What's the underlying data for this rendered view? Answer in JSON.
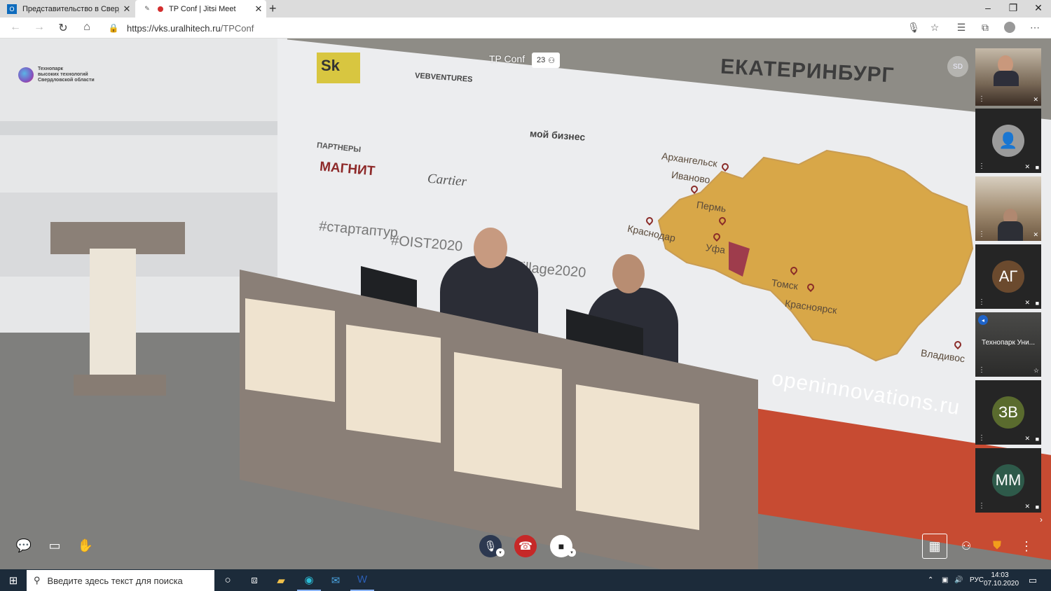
{
  "browser": {
    "tabs": [
      {
        "title": "Представительство в Свердловс",
        "icon": "outlook-icon",
        "active": false
      },
      {
        "title": "TP Conf | Jitsi Meet",
        "icon": "pen-icon",
        "active": true,
        "recording": true
      }
    ],
    "new_tab_label": "+",
    "url_host": "https://vks.uralhitech.ru",
    "url_path": "/TPConf"
  },
  "meeting": {
    "title": "TP Conf",
    "participant_count": "23",
    "local_initials": "SD"
  },
  "org_logo": {
    "line1": "Технопарк",
    "line2": "высоких технологий",
    "line3": "Свердловской области"
  },
  "scene": {
    "city_title": "ЕКАТЕРИНБУРГ",
    "cities": [
      "Архангельск",
      "Иваново",
      "Пермь",
      "Краснодар",
      "Уфа",
      "Томск",
      "Красноярск",
      "Владивос"
    ],
    "partners_heading": "ПАРТНЕРЫ",
    "logos": [
      "МАГНИТ",
      "Cartier",
      "VEBVENTURES",
      "мой бизнес"
    ],
    "hashtags": [
      "#стартаптур",
      "#OIST2020",
      "#OIVillage2020"
    ],
    "site": "openinnovations.ru"
  },
  "filmstrip": [
    {
      "kind": "video",
      "name": "",
      "muted": true
    },
    {
      "kind": "avatar",
      "initials": "",
      "color": "#8a8a8a",
      "muted": true,
      "cam_off": true
    },
    {
      "kind": "video",
      "name": "",
      "muted": true
    },
    {
      "kind": "avatar",
      "initials": "АГ",
      "color": "#6b4a2e",
      "muted": true,
      "cam_off": true
    },
    {
      "kind": "named",
      "name": "Технопарк Уни...",
      "muted": false
    },
    {
      "kind": "avatar",
      "initials": "ЗВ",
      "color": "#5a6b2e",
      "muted": true,
      "cam_off": true
    },
    {
      "kind": "avatar",
      "initials": "ММ",
      "color": "#2e5a4a",
      "muted": true,
      "cam_off": true
    }
  ],
  "toolbar": {
    "chat": "chat-icon",
    "share": "screen-share-icon",
    "hand": "raise-hand-icon",
    "mic": "mic-muted-icon",
    "hangup": "hangup-icon",
    "video": "camera-icon",
    "tile": "tile-view-icon",
    "invite": "invite-icon",
    "security": "security-icon",
    "more": "more-icon"
  },
  "taskbar": {
    "search_placeholder": "Введите здесь текст для поиска",
    "language": "РУС",
    "time": "14:03",
    "date": "07.10.2020"
  }
}
